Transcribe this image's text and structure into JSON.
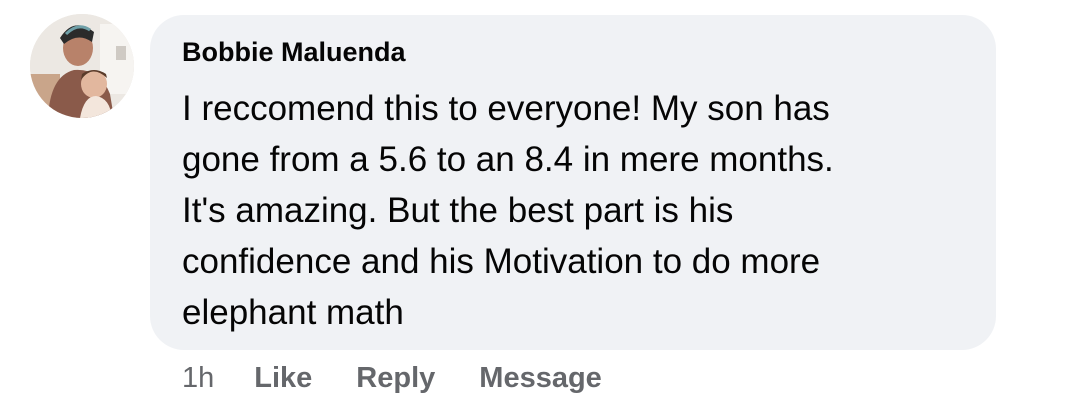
{
  "comment": {
    "author": "Bobbie Maluenda",
    "text_lines": [
      "I reccomend this to everyone! My son has",
      "gone from a 5.6 to an 8.4 in mere months.",
      "It's amazing. But the best part is his",
      "confidence and his Motivation to do more",
      "elephant math"
    ],
    "timestamp": "1h",
    "actions": {
      "like": "Like",
      "reply": "Reply",
      "message": "Message"
    }
  },
  "colors": {
    "bubble_background": "#f0f2f5",
    "text": "#050505",
    "secondary_text": "#65676b"
  }
}
